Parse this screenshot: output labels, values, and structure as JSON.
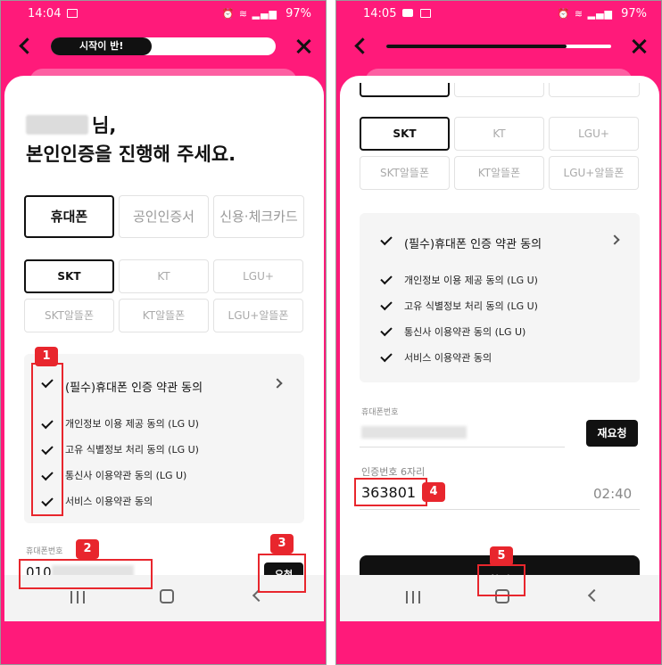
{
  "left_screen": {
    "status": {
      "time": "14:04",
      "battery": "97%"
    },
    "progress": {
      "label": "시작이 반!",
      "fraction": 0.45
    },
    "greeting": {
      "suffix": "님,",
      "line2": "본인인증을 진행해 주세요."
    },
    "auth_tabs": [
      "휴대폰",
      "공인인증서",
      "신용·체크카드"
    ],
    "carriers": [
      "SKT",
      "KT",
      "LGU+",
      "SKT알뜰폰",
      "KT알뜰폰",
      "LGU+알뜰폰"
    ],
    "terms": {
      "main": "(필수)휴대폰 인증 약관 동의",
      "items": [
        "개인정보 이용 제공 동의 (LG U)",
        "고유 식별정보 처리 동의 (LG U)",
        "통신사 이용약관 동의 (LG U)",
        "서비스 이용약관 동의"
      ]
    },
    "phone_field": {
      "label": "휴대폰번호",
      "prefix": "010"
    },
    "request_button": "요청",
    "badges": [
      "1",
      "2",
      "3"
    ]
  },
  "right_screen": {
    "status": {
      "time": "14:05",
      "battery": "97%"
    },
    "progress": {
      "fraction": 0.8
    },
    "carriers": [
      "SKT",
      "KT",
      "LGU+",
      "SKT알뜰폰",
      "KT알뜰폰",
      "LGU+알뜰폰"
    ],
    "terms": {
      "main": "(필수)휴대폰 인증 약관 동의",
      "items": [
        "개인정보 이용 제공 동의 (LG U)",
        "고유 식별정보 처리 동의 (LG U)",
        "통신사 이용약관 동의 (LG U)",
        "서비스 이용약관 동의"
      ]
    },
    "phone_field": {
      "label": "휴대폰번호"
    },
    "resend_button": "재요청",
    "code_field": {
      "label": "인증번호 6자리",
      "value": "363801",
      "timer": "02:40"
    },
    "confirm_button": "확인",
    "badges": [
      "4",
      "5"
    ]
  },
  "colors": {
    "brand": "#ff1a7a",
    "annotation": "#e8262d"
  }
}
